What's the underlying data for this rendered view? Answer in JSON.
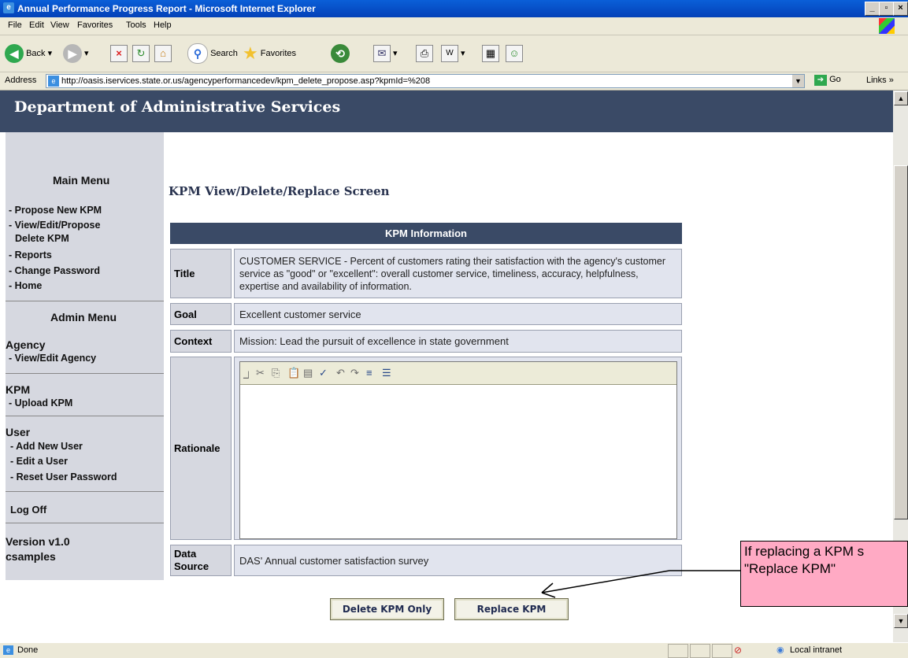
{
  "window": {
    "title": "Annual Performance Progress Report - Microsoft Internet Explorer"
  },
  "menubar": {
    "items": [
      "File",
      "Edit",
      "View",
      "Favorites",
      "Tools",
      "Help"
    ]
  },
  "toolbar": {
    "back": "Back",
    "search": "Search",
    "favorites": "Favorites"
  },
  "address": {
    "label": "Address",
    "url": "http://oasis.iservices.state.or.us/agencyperformancedev/kpm_delete_propose.asp?kpmId=%208",
    "go": "Go",
    "links": "Links"
  },
  "header": {
    "title": "Department of Administrative Services"
  },
  "sidebar": {
    "main_menu": "Main Menu",
    "main_items": [
      "- Propose New KPM",
      "- View/Edit/Propose",
      "Delete KPM",
      "- Reports",
      "- Change Password",
      "- Home"
    ],
    "admin_menu": "Admin Menu",
    "agency": "Agency",
    "agency_items": [
      "- View/Edit Agency"
    ],
    "kpm": "KPM",
    "kpm_items": [
      "- Upload KPM"
    ],
    "user": "User",
    "user_items": [
      "- Add New User",
      "- Edit a User",
      "- Reset User Password"
    ],
    "log_off": "Log Off",
    "version": "Version v1.0",
    "username": "csamples"
  },
  "main": {
    "screen_title": "KPM View/Delete/Replace Screen",
    "table_header": "KPM Information",
    "title_label": "Title",
    "title_value": "CUSTOMER SERVICE - Percent of customers rating their satisfaction with the agency's customer service as \"good\" or \"excellent\": overall customer service, timeliness, accuracy, helpfulness, expertise and availability of information.",
    "goal_label": "Goal",
    "goal_value": "Excellent customer service",
    "context_label": "Context",
    "context_value": "Mission: Lead the pursuit of excellence in state government",
    "rationale_label": "Rationale",
    "rationale_value": "",
    "data_source_label": "Data Source",
    "data_source_value": "DAS' Annual customer satisfaction survey",
    "delete_button": "Delete KPM Only",
    "replace_button": "Replace KPM"
  },
  "callout": {
    "line1": "If replacing a KPM s",
    "line2": "\"Replace KPM\""
  },
  "statusbar": {
    "status": "Done",
    "zone": "Local intranet"
  },
  "colors": {
    "header_bg": "#3a4a66",
    "sidebar_bg": "#d6d8e0",
    "callout_bg": "#ffaac4"
  }
}
